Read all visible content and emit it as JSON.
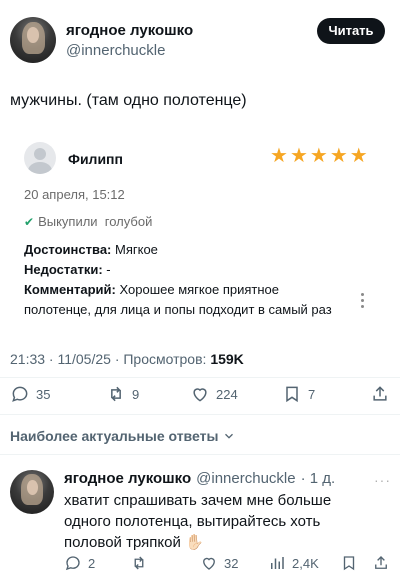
{
  "tweet": {
    "author_name": "ягодное лукошко",
    "author_handle": "@innerchuckle",
    "follow_label": "Читать",
    "text": "мужчины. (там одно полотенце)"
  },
  "review_card": {
    "reviewer_name": "Филипп",
    "rating_stars": 5,
    "date": "20 апреля, 15:12",
    "status": "Выкупили  голубой",
    "lines": [
      {
        "label": "Достоинства:",
        "value": " Мягкое"
      },
      {
        "label": "Недостатки:",
        "value": " -"
      },
      {
        "label": "Комментарий:",
        "value": " Хорошее мягкое приятное"
      }
    ],
    "comment_continuation": "полотенце, для лица и попы подходит в самый раз"
  },
  "meta": {
    "time_date": "21:33 · 11/05/25 · Просмотров: ",
    "views": "159K"
  },
  "actions": {
    "replies": "35",
    "retweets": "9",
    "likes": "224",
    "bookmarks": "7"
  },
  "replies_header": "Наиболее актуальные ответы",
  "reply": {
    "author_name": "ягодное лукошко",
    "author_handle": "@innerchuckle",
    "age": "· 1 д.",
    "text_lines": [
      "хватит спрашивать зачем мне больше",
      "одного полотенца, вытирайтесь хоть",
      "половой тряпкой"
    ],
    "emoji": "✋🏻",
    "replies": "2",
    "likes": "32",
    "views": "2,4K"
  },
  "colors": {
    "star": "#f6a623",
    "check": "#22a06b",
    "text_secondary": "#536471"
  }
}
